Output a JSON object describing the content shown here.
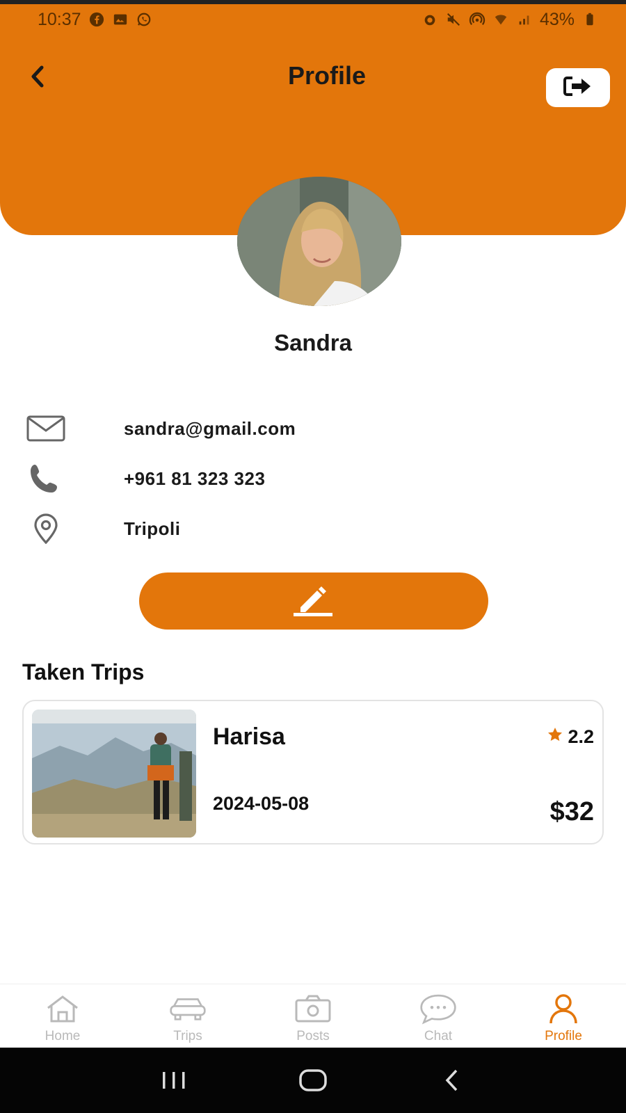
{
  "status_bar": {
    "time": "10:37",
    "battery": "43%"
  },
  "header": {
    "title": "Profile"
  },
  "profile": {
    "name": "Sandra",
    "email": "sandra@gmail.com",
    "phone": "+961 81 323 323",
    "location": "Tripoli"
  },
  "trips": {
    "section_title": "Taken Trips",
    "items": [
      {
        "name": "Harisa",
        "date": "2024-05-08",
        "rating": "2.2",
        "price": "$32"
      }
    ]
  },
  "bottom_nav": {
    "items": [
      {
        "label": "Home",
        "icon": "home-icon"
      },
      {
        "label": "Trips",
        "icon": "car-icon"
      },
      {
        "label": "Posts",
        "icon": "camera-icon"
      },
      {
        "label": "Chat",
        "icon": "chat-bubble-icon"
      },
      {
        "label": "Profile",
        "icon": "user-icon"
      }
    ],
    "active": "Profile"
  },
  "colors": {
    "accent": "#E3760B",
    "inactive": "#b9b9b9"
  }
}
